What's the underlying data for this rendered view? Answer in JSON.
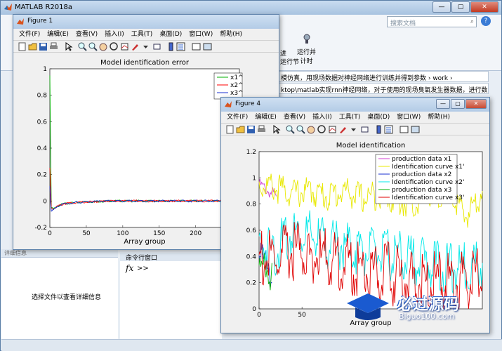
{
  "main": {
    "title": "MATLAB R2018a",
    "search_placeholder": "搜索文档",
    "ribbon_run_section": "运行节",
    "ribbon_advance": "进",
    "ribbon_run_time": "运行并\n计时",
    "path_text": "模仿真，用现场数据对神经网络进行训练并得到参数 › work ›",
    "path_text2": "ktop\\matlab实现rnn神经网络，对于使用的现场臭氧发生器数据，进行数...",
    "detail_header": "详细信息",
    "detail_text": "选择文件以查看详细信息",
    "cmd_title": "命令行窗口",
    "fx": "fx",
    "prompt": ">>"
  },
  "figure1": {
    "title": "Figure 1",
    "menus": [
      "文件(F)",
      "编辑(E)",
      "查看(V)",
      "插入(I)",
      "工具(T)",
      "桌面(D)",
      "窗口(W)",
      "帮助(H)"
    ],
    "colors": {
      "x1": "#00b000",
      "x2": "#ff0000",
      "x3": "#1a2fd0"
    }
  },
  "figure4": {
    "title": "Figure 4",
    "menus": [
      "文件(F)",
      "编辑(E)",
      "查看(V)",
      "插入(I)",
      "工具(T)",
      "桌面(D)",
      "窗口(W)",
      "帮助(H)"
    ],
    "colors": {
      "pd_x1": "#d040d0",
      "ic_x1": "#e8e800",
      "pd_x2": "#1a2fd0",
      "ic_x2": "#00e8e8",
      "pd_x3": "#00b000",
      "ic_x3": "#e00000"
    }
  },
  "chart_data": [
    {
      "type": "line",
      "title": "Model identification error",
      "xlabel": "Array group",
      "ylabel": "",
      "xlim": [
        0,
        260
      ],
      "ylim": [
        -0.2,
        1
      ],
      "xticks": [
        "0",
        "50",
        "100",
        "150",
        "200",
        "25"
      ],
      "yticks": [
        "-0.2",
        "0",
        "0.2",
        "0.4",
        "0.6",
        "0.8",
        "1"
      ],
      "legend": [
        "x1^",
        "x2^",
        "x3^"
      ],
      "legend_position": "top-right",
      "series": [
        {
          "name": "x1^",
          "x": [
            0,
            1,
            2,
            5,
            10,
            20,
            40,
            80,
            150,
            260
          ],
          "y": [
            0.95,
            0.4,
            -0.05,
            -0.06,
            -0.04,
            -0.02,
            -0.01,
            0.0,
            0.0,
            0.0
          ]
        },
        {
          "name": "x2^",
          "x": [
            0,
            1,
            2,
            5,
            10,
            20,
            40,
            80,
            150,
            260
          ],
          "y": [
            0.25,
            0.1,
            -0.05,
            -0.06,
            -0.04,
            -0.02,
            -0.01,
            0.0,
            0.0,
            0.0
          ]
        },
        {
          "name": "x3^",
          "x": [
            0,
            1,
            2,
            5,
            10,
            20,
            40,
            80,
            150,
            260
          ],
          "y": [
            0.12,
            0.0,
            -0.08,
            -0.07,
            -0.04,
            -0.02,
            -0.01,
            0.0,
            0.0,
            0.0
          ]
        }
      ]
    },
    {
      "type": "line",
      "title": "Model identification",
      "xlabel": "Array group",
      "ylabel": "",
      "xlim": [
        0,
        260
      ],
      "ylim": [
        0,
        1.2
      ],
      "yticks": [
        "0",
        "0.2",
        "0.4",
        "0.6",
        "0.8",
        "1",
        "1.2"
      ],
      "xticks": [
        "0",
        "50"
      ],
      "legend": [
        "production data x1",
        "Identification curve x1'",
        "production data x2",
        "Identification curve x2'",
        "production data x3",
        "Identification curve x3'"
      ],
      "legend_position": "top-right",
      "series": [
        {
          "name": "production data x1",
          "x": [
            0,
            5,
            10,
            15,
            20
          ],
          "y": [
            0.95,
            0.93,
            0.9,
            0.88,
            0.86
          ]
        },
        {
          "name": "Identification curve x1'",
          "x": [
            0,
            20,
            40,
            60,
            80,
            100,
            120,
            140,
            160,
            180,
            200,
            220,
            240,
            260
          ],
          "y": [
            0.95,
            0.92,
            0.88,
            0.9,
            0.86,
            0.9,
            0.84,
            0.88,
            0.82,
            0.8,
            0.86,
            0.92,
            0.7,
            0.9
          ]
        },
        {
          "name": "production data x2",
          "x": [
            0,
            5,
            10,
            15
          ],
          "y": [
            0.55,
            0.3,
            0.4,
            0.2
          ]
        },
        {
          "name": "Identification curve x2'",
          "x": [
            0,
            20,
            40,
            60,
            80,
            100,
            120,
            140,
            160,
            180,
            200,
            220,
            240,
            260
          ],
          "y": [
            0.5,
            0.45,
            0.6,
            0.55,
            0.5,
            0.48,
            0.45,
            0.42,
            0.4,
            0.38,
            0.35,
            0.3,
            0.32,
            0.35
          ]
        },
        {
          "name": "production data x3",
          "x": [
            0,
            5,
            10,
            15
          ],
          "y": [
            0.45,
            0.3,
            0.2,
            0.35
          ]
        },
        {
          "name": "Identification curve x3'",
          "x": [
            0,
            20,
            40,
            60,
            80,
            100,
            120,
            140,
            160,
            180,
            200,
            220,
            240,
            260
          ],
          "y": [
            0.4,
            0.35,
            0.45,
            0.4,
            0.38,
            0.35,
            0.3,
            0.28,
            0.25,
            0.22,
            0.2,
            0.18,
            0.2,
            0.22
          ]
        }
      ]
    }
  ],
  "watermark": {
    "brand": "必过源码",
    "url": "Biguo100.com"
  }
}
